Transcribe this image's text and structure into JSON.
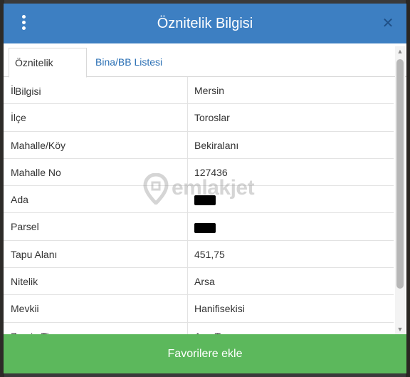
{
  "dialog": {
    "title": "Öznitelik Bilgisi",
    "close_glyph": "✕",
    "accent_color": "#3d7fc2",
    "button_color": "#5cb85c"
  },
  "tabs": [
    {
      "label": "Öznitelik Bilgisi",
      "active": true
    },
    {
      "label": "Bina/BB Listesi",
      "active": false
    }
  ],
  "attributes": [
    {
      "key": "İl",
      "value": "Mersin"
    },
    {
      "key": "İlçe",
      "value": "Toroslar"
    },
    {
      "key": "Mahalle/Köy",
      "value": "Bekiralanı"
    },
    {
      "key": "Mahalle No",
      "value": "127436"
    },
    {
      "key": "Ada",
      "value": "",
      "redacted": true
    },
    {
      "key": "Parsel",
      "value": "",
      "redacted": true
    },
    {
      "key": "Tapu Alanı",
      "value": "451,75"
    },
    {
      "key": "Nitelik",
      "value": "Arsa"
    },
    {
      "key": "Mevkii",
      "value": "Hanifisekisi"
    },
    {
      "key": "Zemin Tip",
      "value": "Ana Taşınmaz"
    }
  ],
  "watermark": {
    "text": "emlakjet"
  },
  "footer": {
    "button_label": "Favorilere ekle"
  },
  "icons": {
    "menu": "kebab-menu-icon",
    "close": "close-icon",
    "scroll_up": "scroll-up-arrow-icon",
    "scroll_down": "scroll-down-arrow-icon"
  }
}
